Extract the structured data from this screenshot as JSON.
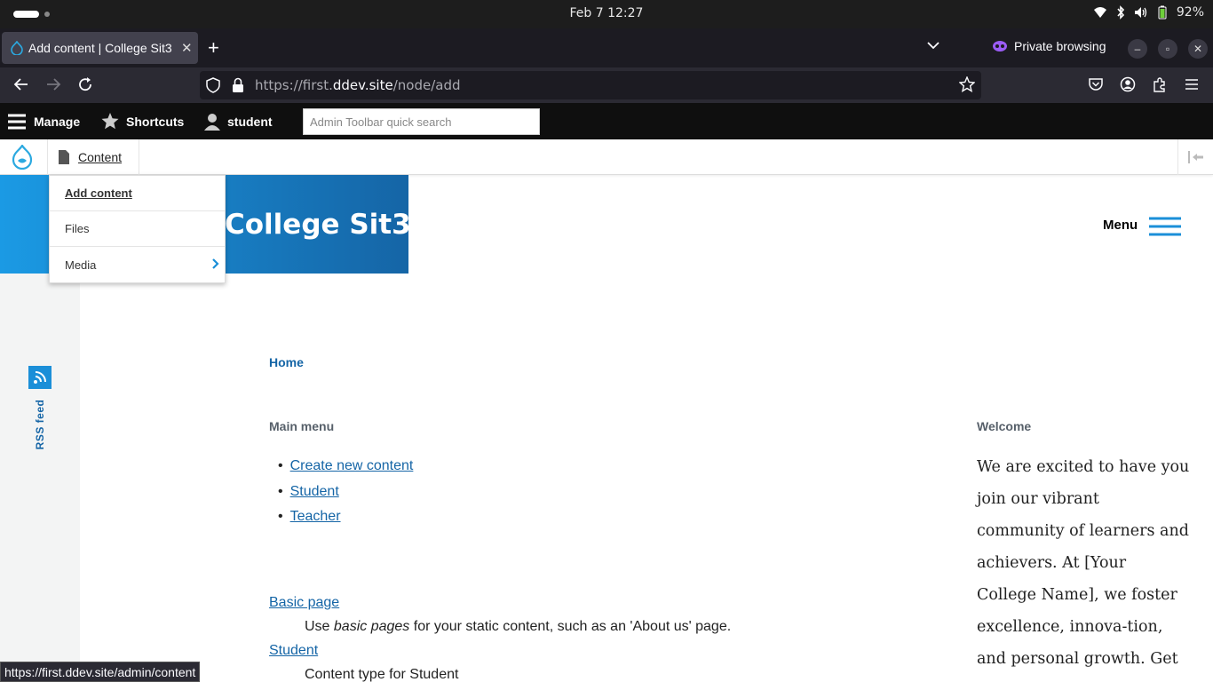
{
  "os": {
    "clock": "Feb 7  12:27",
    "battery": "92%"
  },
  "browser": {
    "tab_title": "Add content | College Sit3",
    "private_label": "Private browsing",
    "url_prefix": "https://first.",
    "url_domain": "ddev.site",
    "url_path": "/node/add",
    "status_url": "https://first.ddev.site/admin/content"
  },
  "admin_toolbar": {
    "manage": "Manage",
    "shortcuts": "Shortcuts",
    "user": "student",
    "search_placeholder": "Admin Toolbar quick search",
    "tray_item": "Content"
  },
  "dropdown": {
    "items": [
      {
        "label": "Add content"
      },
      {
        "label": "Files"
      },
      {
        "label": "Media"
      }
    ]
  },
  "site": {
    "banner_title": "College Sit3",
    "menu_label": "Menu",
    "rss_label": "RSS feed",
    "breadcrumb": "Home"
  },
  "main_menu": {
    "heading": "Main menu",
    "items": [
      "Create new content",
      "Student",
      "Teacher"
    ]
  },
  "content_types": [
    {
      "name": "Basic page",
      "desc_pre": "Use ",
      "desc_em": "basic pages",
      "desc_post": " for your static content, such as an 'About us' page."
    },
    {
      "name": "Student",
      "desc_pre": "Content type for Student",
      "desc_em": "",
      "desc_post": ""
    }
  ],
  "welcome": {
    "heading": "Welcome",
    "text": "We are excited to have you join our vibrant community of learners and achievers. At [Your College Name], we foster excellence, innova-tion, and personal growth. Get ready for an enriching"
  },
  "colors": {
    "brand_blue": "#1565a6",
    "banner_light": "#1b9ae4",
    "toolbar_black": "#0f0f0f"
  }
}
